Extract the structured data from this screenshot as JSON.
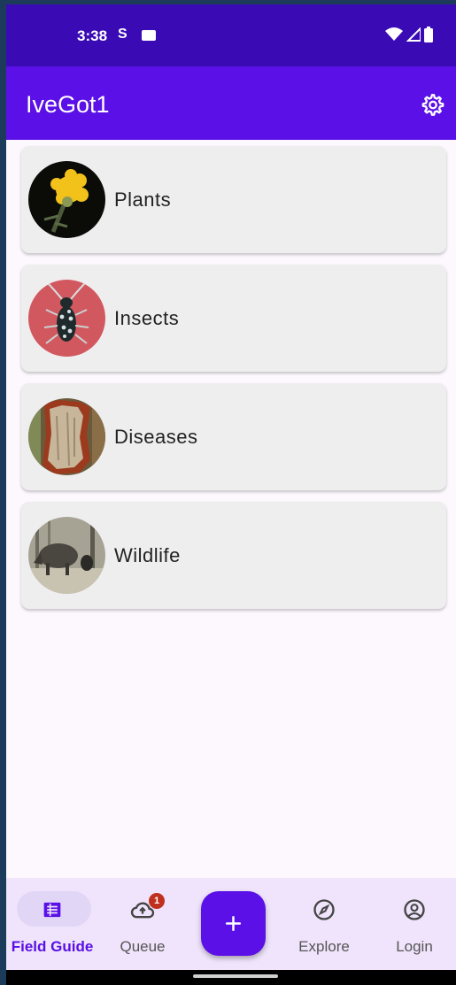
{
  "status_bar": {
    "time": "3:38",
    "s_icon": "S"
  },
  "app_bar": {
    "title": "IveGot1",
    "settings_icon": "gear-icon"
  },
  "categories": [
    {
      "label": "Plants",
      "image": "yellow-thistle-flower"
    },
    {
      "label": "Insects",
      "image": "beetle-on-red"
    },
    {
      "label": "Diseases",
      "image": "diseased-tree-bark"
    },
    {
      "label": "Wildlife",
      "image": "wild-boar-in-forest"
    }
  ],
  "bottom_nav": {
    "items": [
      {
        "label": "Field Guide",
        "icon": "list-icon",
        "active": true
      },
      {
        "label": "Queue",
        "icon": "cloud-upload-icon",
        "badge": "1"
      },
      {
        "label": "Explore",
        "icon": "compass-icon"
      },
      {
        "label": "Login",
        "icon": "account-circle-icon"
      }
    ],
    "fab_icon": "plus-icon"
  },
  "colors": {
    "status_bar": "#3a0ab5",
    "primary": "#5a10e6",
    "nav_bg": "#efe4fb",
    "badge": "#c0301f"
  }
}
